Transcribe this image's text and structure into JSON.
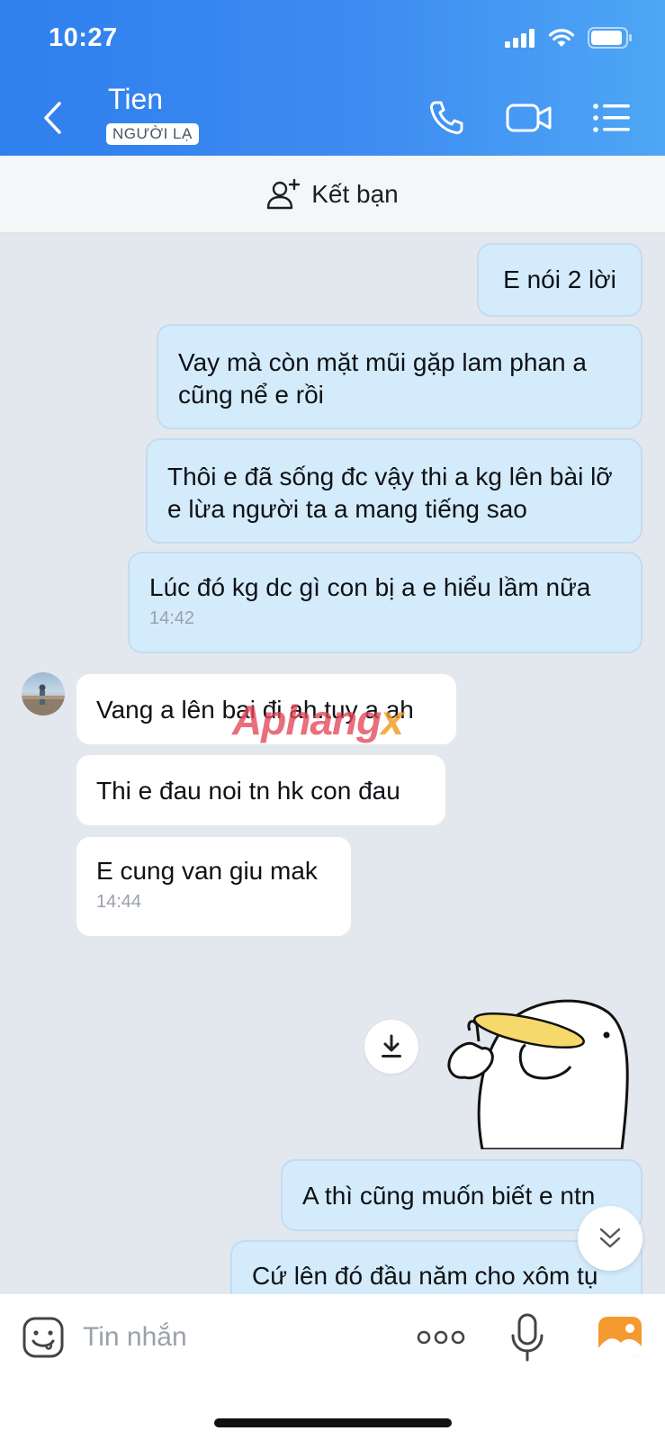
{
  "status_bar": {
    "time": "10:27"
  },
  "header": {
    "name": "Tien",
    "badge": "NGƯỜI LẠ"
  },
  "add_friend": {
    "label": "Kết bạn"
  },
  "messages": [
    {
      "dir": "out",
      "text": "E nói 2 lời"
    },
    {
      "dir": "out",
      "text": "Vay mà còn mặt mũi gặp lam phan a cũng nể e rồi"
    },
    {
      "dir": "out",
      "text": "Thôi e đã sống đc vậy thi a kg lên bài lỡ e lừa người ta a mang tiếng sao"
    },
    {
      "dir": "out",
      "text": "Lúc đó kg dc gì con bị a e hiểu lầm nữa",
      "time": "14:42"
    },
    {
      "dir": "in",
      "text": "Vang a lên bai đi ah.tuy a ah"
    },
    {
      "dir": "in",
      "text": "Thi e đau noi tn hk con đau"
    },
    {
      "dir": "in",
      "text": "E cung van giu mak",
      "time": "14:44"
    },
    {
      "dir": "out",
      "text": "A thì cũng muốn biết e ntn"
    },
    {
      "dir": "out",
      "text": "Cứ lên đó đầu năm cho xôm tụ"
    }
  ],
  "watermark": {
    "main": "Aphang",
    "suffix": "x"
  },
  "composer": {
    "placeholder": "Tin nhắn"
  },
  "colors": {
    "header_start": "#2f7fee",
    "header_end": "#4ea6f5",
    "bubble_out": "#d4ebfb",
    "bubble_in": "#ffffff",
    "chat_bg": "#e3e7ee"
  }
}
